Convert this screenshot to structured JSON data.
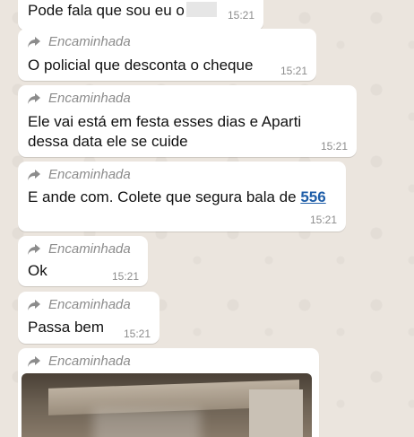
{
  "messages": [
    {
      "forwarded": false,
      "text": "Pode fala que sou eu o",
      "redacted": true,
      "time": "15:21"
    },
    {
      "forwarded": true,
      "forward_label": "Encaminhada",
      "text": "O policial que desconta o cheque",
      "time": "15:21"
    },
    {
      "forwarded": true,
      "forward_label": "Encaminhada",
      "text_line1": "Ele vai está em festa esses dias e Aparti",
      "text_line2": "dessa data ele se cuide",
      "time": "15:21"
    },
    {
      "forwarded": true,
      "forward_label": "Encaminhada",
      "text": "E ande com. Colete que segura bala de ",
      "link": "556",
      "time": "15:21"
    },
    {
      "forwarded": true,
      "forward_label": "Encaminhada",
      "text": "Ok",
      "time": "15:21"
    },
    {
      "forwarded": true,
      "forward_label": "Encaminhada",
      "text": "Passa bem",
      "time": "15:21"
    },
    {
      "forwarded": true,
      "forward_label": "Encaminhada",
      "media": "photo"
    }
  ],
  "colors": {
    "chat_background": "#ebe5de",
    "bubble": "#ffffff",
    "meta_text": "#8c8c8c",
    "link": "#1f5ea8"
  },
  "icons": {
    "forward": "forward-arrow-icon"
  }
}
